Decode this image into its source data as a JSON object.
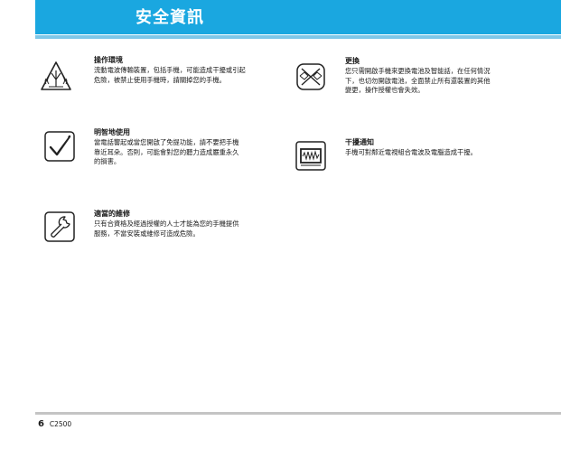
{
  "header": {
    "title": "安全資訊"
  },
  "items": [
    {
      "icon": "vehicle-interference-icon",
      "title": "操作環境",
      "body": "流動電波傳輸裝置，包括手機，可能造成干擾或引起\n危險，被禁止使用手機時，請關掉您的手機。"
    },
    {
      "icon": "no-tampering-icon",
      "title": "更換",
      "body": "您只需開啟手機來更換電池及智能話，在任何情況\n下，也切勿開啟電池，全面禁止所有還裝置的其他\n變更，操作授權也會失效。"
    },
    {
      "icon": "checkmark-icon",
      "title": "明智地使用",
      "body": "當電話響起或當您開啟了免提功能，請不要把手機\n靠近耳朵。否則，可能會對您的聽力造成嚴重永久\n的損害。"
    },
    {
      "icon": "monitor-icon",
      "title": "干擾通知",
      "body": "手機可對鄰近電視組合電波及電腦造成干擾。"
    },
    {
      "icon": "wrench-icon",
      "title": "適當的維修",
      "body": "只有合資格及經過授權的人士才能為您的手機提供\n服務，不當安裝或維修可造成危險。"
    }
  ],
  "footer": {
    "page_number": "6",
    "model": "C2500"
  },
  "colors": {
    "header_blue": "#1aa7e0",
    "header_line": "#7fc7e8",
    "footer_line": "#c4c4c4"
  }
}
